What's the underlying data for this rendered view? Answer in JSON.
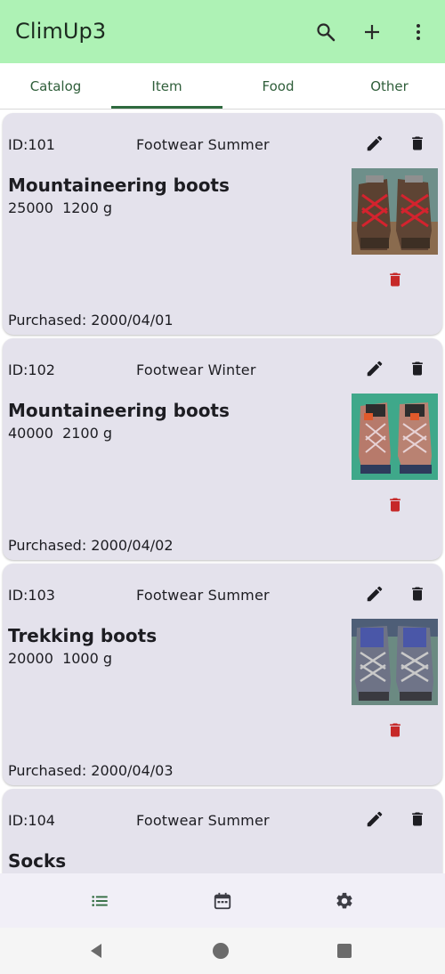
{
  "app": {
    "title": "ClimUp3"
  },
  "toolbar": {
    "search_icon": "search-icon",
    "add_icon": "plus-icon",
    "more_icon": "more-vert-icon"
  },
  "tabs": [
    {
      "label": "Catalog",
      "selected": false
    },
    {
      "label": "Item",
      "selected": true
    },
    {
      "label": "Food",
      "selected": false
    },
    {
      "label": "Other",
      "selected": false
    }
  ],
  "items": [
    {
      "id": "ID:101",
      "category": "Footwear Summer",
      "name": "Mountaineering boots",
      "meta": "25000  1200 g",
      "purchased": "Purchased: 2000/04/01",
      "photo": "red-laced-brown-boots"
    },
    {
      "id": "ID:102",
      "category": "Footwear Winter",
      "name": "Mountaineering boots",
      "meta": "40000  2100 g",
      "purchased": "Purchased: 2000/04/02",
      "photo": "winter-boots-on-green-cloth"
    },
    {
      "id": "ID:103",
      "category": "Footwear Summer",
      "name": "Trekking boots",
      "meta": "20000  1000 g",
      "purchased": "Purchased: 2000/04/03",
      "photo": "blue-trekking-boots"
    },
    {
      "id": "ID:104",
      "category": "Footwear Summer",
      "name": "Socks",
      "meta": "",
      "purchased": "",
      "photo": ""
    }
  ],
  "bottom_nav": [
    {
      "icon": "list-icon",
      "selected": true
    },
    {
      "icon": "calendar-icon",
      "selected": false
    },
    {
      "icon": "settings-icon",
      "selected": false
    }
  ],
  "colors": {
    "app_bar": "#aef2b5",
    "tab_text": "#2f5e3a",
    "card_bg": "#e4e2ec",
    "delete_red": "#c62828",
    "nav_bg": "#f1eff7"
  }
}
